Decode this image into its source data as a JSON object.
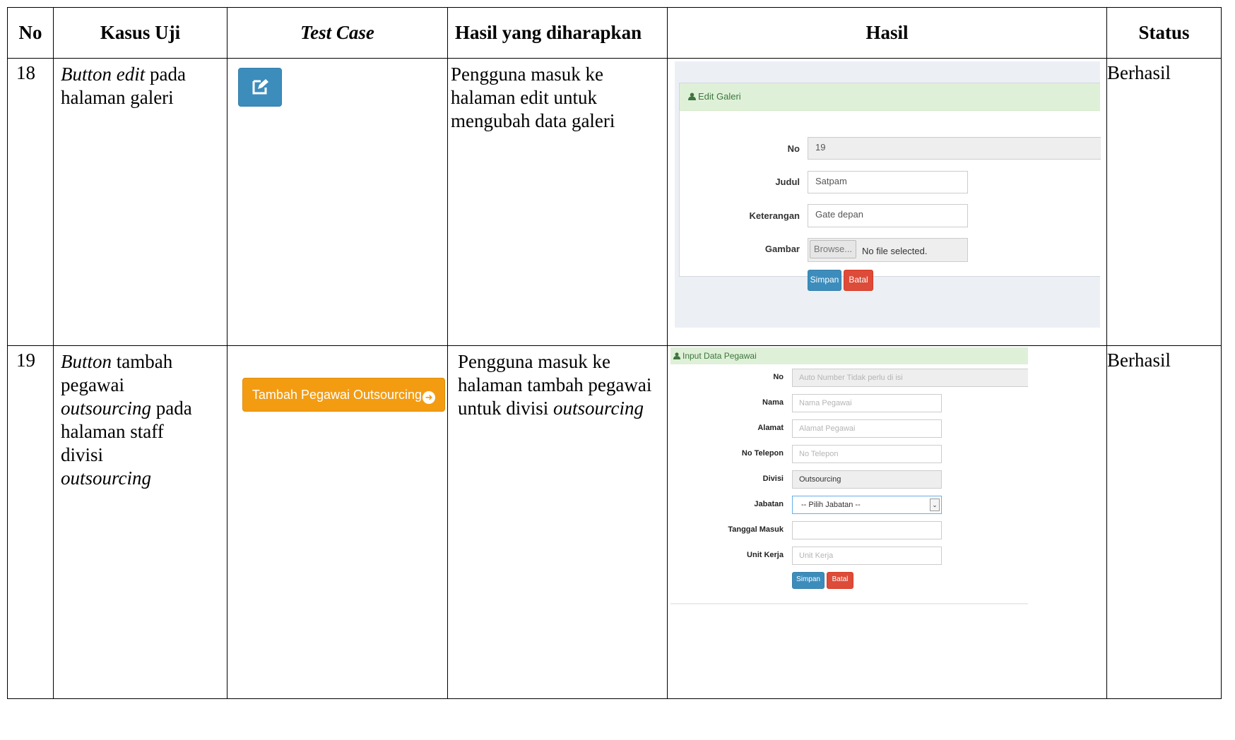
{
  "headers": {
    "no": "No",
    "kasus_uji": "Kasus Uji",
    "test_case": "Test Case",
    "hasil_diharapkan": "Hasil yang diharapkan",
    "hasil": "Hasil",
    "status": "Status"
  },
  "rows": [
    {
      "no": "18",
      "kasus_uji_italic": "Button edit",
      "kasus_uji_rest": "pada halaman galeri",
      "expected": "Pengguna masuk ke halaman edit untuk mengubah data galeri",
      "status": "Berhasil",
      "test_case_icon": "edit-icon",
      "screenshot": {
        "panel_title": "Edit Galeri",
        "panel_icon": "user-icon",
        "fields": {
          "no_label": "No",
          "no_value": "19",
          "judul_label": "Judul",
          "judul_value": "Satpam",
          "keterangan_label": "Keterangan",
          "keterangan_value": "Gate depan",
          "gambar_label": "Gambar",
          "browse_label": "Browse...",
          "file_status": "No file selected."
        },
        "simpan_label": "Simpan",
        "batal_label": "Batal"
      }
    },
    {
      "no": "19",
      "kasus_uji_line1_italic": "Button",
      "kasus_uji_line1_rest": "tambah",
      "kasus_uji_line2": "pegawai",
      "kasus_uji_line3_italic": "outsourcing",
      "kasus_uji_line3_rest": "pada",
      "kasus_uji_line4": "halaman staff",
      "kasus_uji_line5": "divisi",
      "kasus_uji_line6_italic": "outsourcing",
      "expected_plain": "Pengguna masuk ke halaman tambah pegawai untuk divisi",
      "expected_italic": "outsourcing",
      "status": "Berhasil",
      "test_case_button": "Tambah Pegawai Outsourcing",
      "test_case_button_icon": "arrow-circle-right-icon",
      "screenshot": {
        "panel_title": "Input Data Pegawai",
        "panel_icon": "user-icon",
        "fields": {
          "no_label": "No",
          "no_placeholder": "Auto Number Tidak perlu di isi",
          "nama_label": "Nama",
          "nama_placeholder": "Nama Pegawai",
          "alamat_label": "Alamat",
          "alamat_placeholder": "Alamat Pegawai",
          "telepon_label": "No Telepon",
          "telepon_placeholder": "No Telepon",
          "divisi_label": "Divisi",
          "divisi_value": "Outsourcing",
          "jabatan_label": "Jabatan",
          "jabatan_value": "-- Pilih Jabatan --",
          "tanggal_label": "Tanggal Masuk",
          "tanggal_value": "",
          "unit_label": "Unit Kerja",
          "unit_placeholder": "Unit Kerja"
        },
        "simpan_label": "Simpan",
        "batal_label": "Batal"
      }
    }
  ],
  "colors": {
    "primary": "#3c8dbc",
    "danger": "#dd4b39",
    "warning": "#f39c12",
    "success_bg": "#dff0d8",
    "success_text": "#3c763d"
  }
}
